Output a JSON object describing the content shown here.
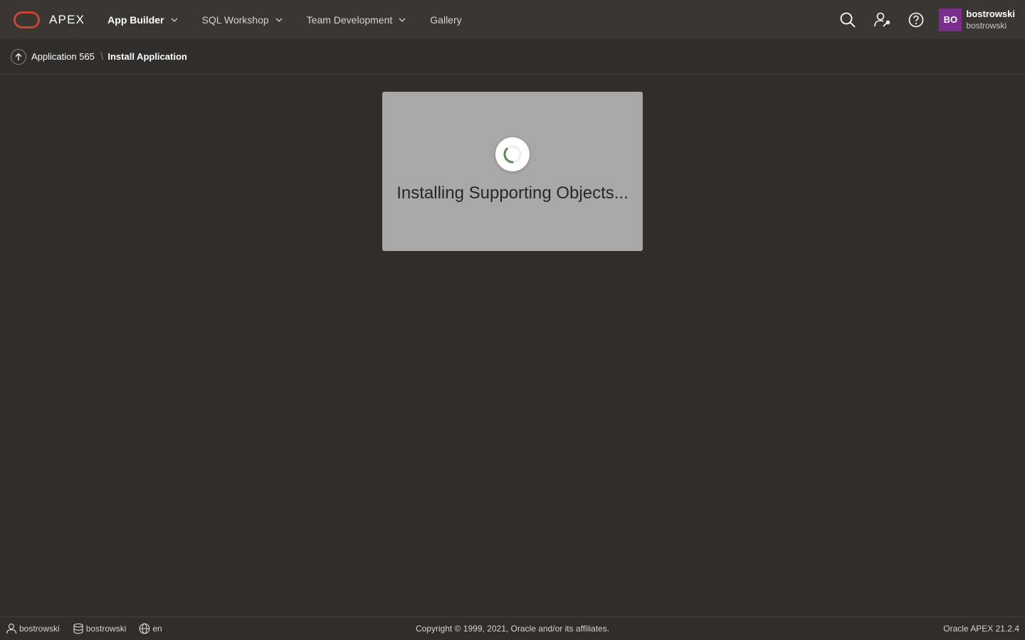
{
  "header": {
    "logo_text": "APEX",
    "nav": [
      {
        "label": "App Builder"
      },
      {
        "label": "SQL Workshop"
      },
      {
        "label": "Team Development"
      },
      {
        "label": "Gallery"
      }
    ],
    "tools": [
      "search-icon",
      "administration-icon",
      "help-icon"
    ],
    "user": {
      "initials": "BO",
      "name": "bostrowski",
      "workspace": "bostrowski"
    }
  },
  "breadcrumb": {
    "parent": "Application 565",
    "current": "Install Application"
  },
  "dialog": {
    "message": "Installing Supporting Objects..."
  },
  "footer": {
    "user": "bostrowski",
    "workspace": "bostrowski",
    "language": "en",
    "copyright": "Copyright © 1999, 2021, Oracle and/or its affiliates.",
    "version": "Oracle APEX 21.2.4"
  },
  "colors": {
    "background": "#312d2a",
    "topbar": "#3a3632",
    "logo": "#c74634",
    "avatar": "#7b2e8e",
    "dialog": "#a9a8a6",
    "spinner_accent": "#5a8a5a"
  }
}
